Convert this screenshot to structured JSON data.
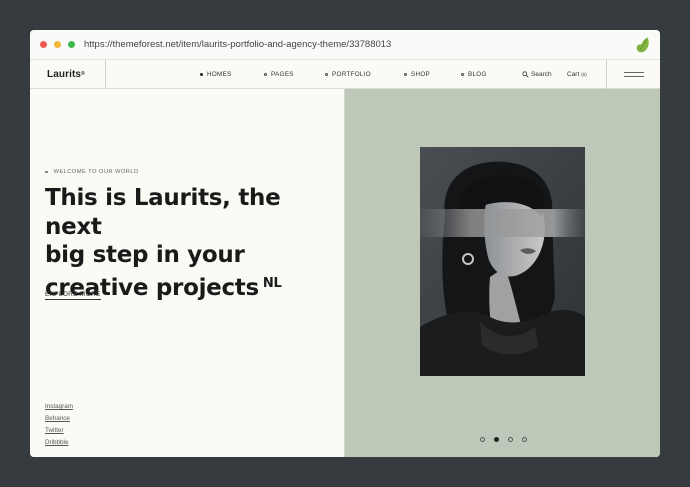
{
  "browser": {
    "url": "https://themeforest.net/item/laurits-portfolio-and-agency-theme/33788013"
  },
  "header": {
    "logo": "Laurits",
    "logo_mark": "®",
    "nav": [
      {
        "label": "HOMES",
        "active": true
      },
      {
        "label": "PAGES",
        "active": false
      },
      {
        "label": "PORTFOLIO",
        "active": false
      },
      {
        "label": "SHOP",
        "active": false
      },
      {
        "label": "BLOG",
        "active": false
      }
    ],
    "search_label": "Search",
    "cart_label": "Cart",
    "cart_count": "(0)"
  },
  "hero": {
    "eyebrow": "WELCOME TO OUR WORLD",
    "headline_line1": "This is Laurits, the next",
    "headline_line2": "big step in your",
    "headline_line3": "creative projects",
    "headline_sup": "NL",
    "cta": "EXPLORE MORE"
  },
  "socials": [
    "Instagram",
    "Behance",
    "Twitter",
    "Dribbble"
  ],
  "slider": {
    "total": 4,
    "active_index": 1
  },
  "colors": {
    "page_bg": "#363b3f",
    "content_bg": "#fbfaf5",
    "right_panel_bg": "#bec8b8",
    "envato_green": "#82b541"
  }
}
